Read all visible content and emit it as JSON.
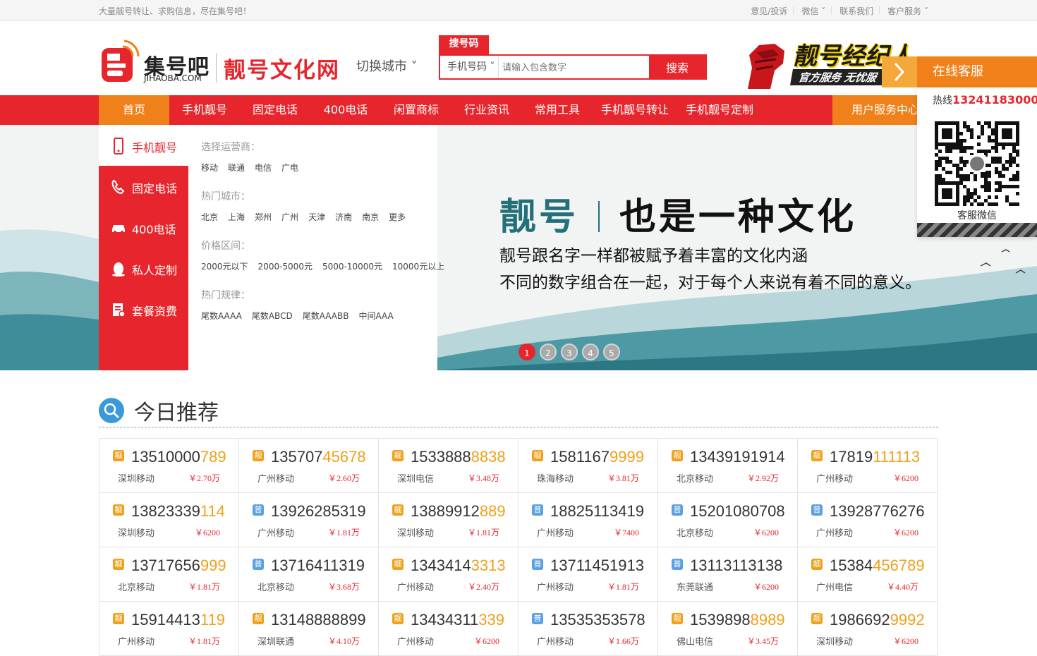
{
  "topbar": {
    "slogan": "大量靓号转让、求购信息，尽在集号吧！",
    "links": [
      "意见/投诉",
      "微信 ˅",
      "联系我们",
      "客户服务 ˅"
    ]
  },
  "header": {
    "logo_name": "集号吧",
    "logo_domain": "JIHAOBA.COM",
    "site_name": "靓号文化网",
    "switch_city": "切换城市 ˅",
    "search_tab": "搜号码",
    "search_type": "手机号码 ˅",
    "search_placeholder": "请输入包含数字",
    "search_button": "搜索",
    "agent_title": "靓号经纪人",
    "agent_sub": "官方服务 无忧服"
  },
  "nav": {
    "items": [
      "首页",
      "手机靓号",
      "固定电话",
      "400电话",
      "闲置商标",
      "行业资讯",
      "常用工具",
      "手机靓号转让",
      "手机靓号定制"
    ],
    "user_center": "用户服务中心"
  },
  "side_menu": [
    "手机靓号",
    "固定电话",
    "400电话",
    "私人定制",
    "套餐资费"
  ],
  "filters": [
    {
      "title": "选择运营商：",
      "options": [
        "移动",
        "联通",
        "电信",
        "广电"
      ]
    },
    {
      "title": "热门城市：",
      "options": [
        "北京",
        "上海",
        "郑州",
        "广州",
        "天津",
        "济南",
        "南京",
        "更多"
      ]
    },
    {
      "title": "价格区间：",
      "options": [
        "2000元以下",
        "2000-5000元",
        "5000-10000元",
        "10000元以上"
      ]
    },
    {
      "title": "热门规律：",
      "options": [
        "尾数AAAA",
        "尾数ABCD",
        "尾数AAABB",
        "中间AAA"
      ]
    }
  ],
  "slide": {
    "head_a": "靓号",
    "head_b": "也是一种文化",
    "line1": "靓号跟名字一样都被赋予着丰富的文化内涵",
    "line2": "不同的数字组合在一起，对于每个人来说有着不同的意义。",
    "dots": [
      "1",
      "2",
      "3",
      "4",
      "5"
    ],
    "active_dot": 1
  },
  "today": {
    "title": "今日推荐"
  },
  "numbers": [
    {
      "tag": "靓",
      "type": "liang",
      "a": "13510000",
      "b": "789",
      "city": "深圳移动",
      "price": "￥2.70万"
    },
    {
      "tag": "靓",
      "type": "liang",
      "a": "135707",
      "b": "45678",
      "city": "广州移动",
      "price": "￥2.60万"
    },
    {
      "tag": "靓",
      "type": "liang",
      "a": "1533888",
      "b": "8838",
      "city": "深圳电信",
      "price": "￥3.48万"
    },
    {
      "tag": "靓",
      "type": "liang",
      "a": "1581167",
      "b": "9999",
      "city": "珠海移动",
      "price": "￥3.81万"
    },
    {
      "tag": "靓",
      "type": "liang",
      "a": "13439191914",
      "b": "",
      "city": "北京移动",
      "price": "￥2.92万"
    },
    {
      "tag": "靓",
      "type": "liang",
      "a": "17819",
      "b": "111113",
      "city": "广州移动",
      "price": "￥6200"
    },
    {
      "tag": "靓",
      "type": "liang",
      "a": "13823339",
      "b": "114",
      "city": "深圳移动",
      "price": "￥6200"
    },
    {
      "tag": "普",
      "type": "pu",
      "a": "13926285319",
      "b": "",
      "city": "广州移动",
      "price": "￥1.81万"
    },
    {
      "tag": "靓",
      "type": "liang",
      "a": "13889912",
      "b": "889",
      "city": "深圳移动",
      "price": "￥1.81万"
    },
    {
      "tag": "普",
      "type": "pu",
      "a": "18825113419",
      "b": "",
      "city": "广州移动",
      "price": "￥7400"
    },
    {
      "tag": "普",
      "type": "pu",
      "a": "15201080708",
      "b": "",
      "city": "北京移动",
      "price": "￥6200"
    },
    {
      "tag": "普",
      "type": "pu",
      "a": "13928776276",
      "b": "",
      "city": "广州移动",
      "price": "￥6200"
    },
    {
      "tag": "靓",
      "type": "liang",
      "a": "13717656",
      "b": "999",
      "city": "北京移动",
      "price": "￥1.81万"
    },
    {
      "tag": "普",
      "type": "pu",
      "a": "13716411319",
      "b": "",
      "city": "北京移动",
      "price": "￥3.68万"
    },
    {
      "tag": "靓",
      "type": "liang",
      "a": "1343414",
      "b": "3313",
      "city": "广州移动",
      "price": "￥2.40万"
    },
    {
      "tag": "普",
      "type": "pu",
      "a": "13711451913",
      "b": "",
      "city": "广州移动",
      "price": "￥1.81万"
    },
    {
      "tag": "普",
      "type": "pu",
      "a": "13113113138",
      "b": "",
      "city": "东莞联通",
      "price": "￥6200"
    },
    {
      "tag": "靓",
      "type": "liang",
      "a": "15384",
      "b": "456789",
      "city": "广州电信",
      "price": "￥4.40万"
    },
    {
      "tag": "靓",
      "type": "liang",
      "a": "15914413",
      "b": "119",
      "city": "广州移动",
      "price": "￥1.81万"
    },
    {
      "tag": "靓",
      "type": "liang",
      "a": "13148888899",
      "b": "",
      "city": "深圳联通",
      "price": "￥4.10万"
    },
    {
      "tag": "靓",
      "type": "liang",
      "a": "13434311",
      "b": "339",
      "city": "广州移动",
      "price": "￥6200"
    },
    {
      "tag": "普",
      "type": "pu",
      "a": "13535353578",
      "b": "",
      "city": "广州移动",
      "price": "￥1.66万"
    },
    {
      "tag": "靓",
      "type": "liang",
      "a": "1539898",
      "b": "8989",
      "city": "佛山电信",
      "price": "￥3.45万"
    },
    {
      "tag": "靓",
      "type": "liang",
      "a": "1986692",
      "b": "9992",
      "city": "深圳移动",
      "price": "￥6200"
    }
  ],
  "cs": {
    "title": "在线客服",
    "hotline_label": "热线",
    "hotline": "13241183000",
    "qr_caption": "客服微信"
  },
  "colors": {
    "brand_red": "#e6262c",
    "accent_orange": "#f08019",
    "highlight": "#f0a019",
    "plain_blue": "#5ba0e0"
  }
}
